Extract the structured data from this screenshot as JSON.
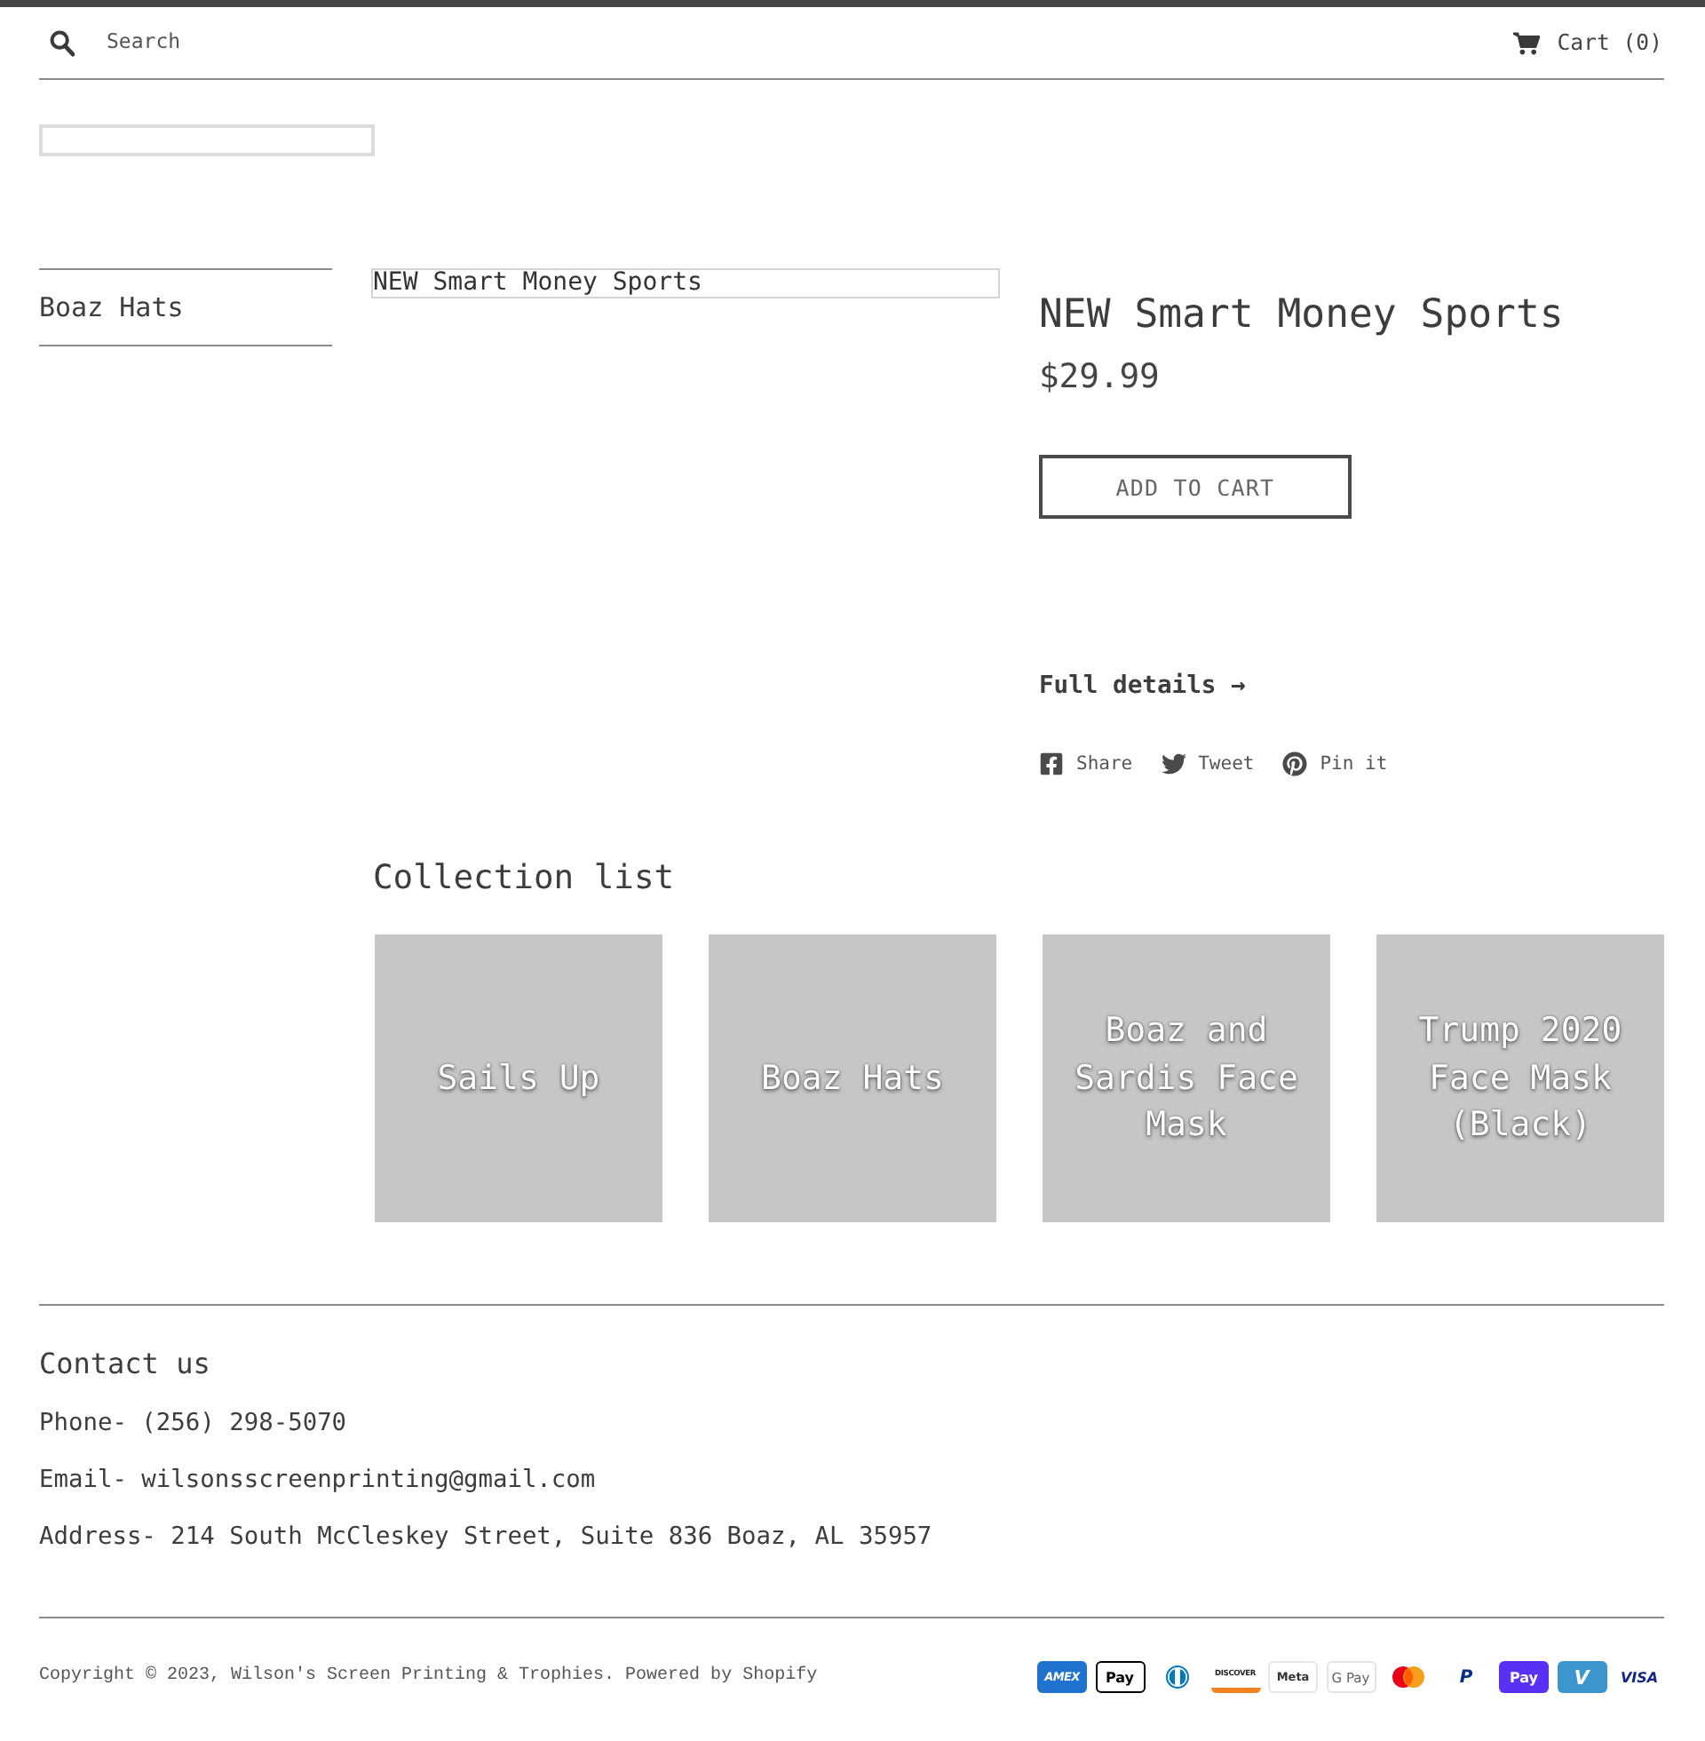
{
  "header": {
    "search": {
      "placeholder": "Search"
    },
    "cart": {
      "label": "Cart (0)"
    }
  },
  "sidebar": {
    "items": [
      {
        "label": "Boaz Hats"
      }
    ]
  },
  "product": {
    "image_alt": "NEW Smart Money Sports",
    "title": "NEW Smart Money Sports",
    "price": "$29.99",
    "add_to_cart": "ADD TO CART",
    "full_details": "Full details →",
    "share": [
      {
        "kind": "facebook",
        "label": "Share"
      },
      {
        "kind": "twitter",
        "label": "Tweet"
      },
      {
        "kind": "pinterest",
        "label": "Pin it"
      }
    ]
  },
  "collection_list": {
    "title": "Collection list",
    "items": [
      {
        "title": "Sails Up"
      },
      {
        "title": "Boaz Hats"
      },
      {
        "title": "Boaz and Sardis Face Mask"
      },
      {
        "title": "Trump 2020 Face Mask (Black)"
      }
    ]
  },
  "footer": {
    "contact": {
      "title": "Contact us",
      "lines": [
        "Phone- (256) 298-5070",
        "Email- wilsonsscreenprinting@gmail.com",
        "Address- 214 South McCleskey Street, Suite 836 Boaz, AL 35957"
      ]
    },
    "copyright": "Copyright © 2023, Wilson's Screen Printing & Trophies. Powered by Shopify",
    "payment_methods": [
      {
        "kind": "amex",
        "text": "AMEX"
      },
      {
        "kind": "apple_pay",
        "text": "Pay"
      },
      {
        "kind": "diners"
      },
      {
        "kind": "discover",
        "text": "DISCOVER"
      },
      {
        "kind": "meta_pay",
        "text": "Meta"
      },
      {
        "kind": "google_pay",
        "text": "G Pay"
      },
      {
        "kind": "mastercard"
      },
      {
        "kind": "paypal",
        "text": "P"
      },
      {
        "kind": "shop_pay",
        "text": "Pay"
      },
      {
        "kind": "venmo",
        "text": "V"
      },
      {
        "kind": "visa",
        "text": "VISA"
      }
    ]
  }
}
